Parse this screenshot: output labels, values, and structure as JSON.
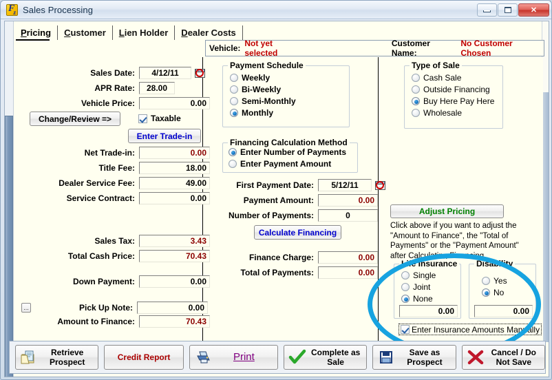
{
  "window": {
    "title": "Sales Processing",
    "icon": "app-icon-fz",
    "buttons": {
      "minimize": "minimize",
      "maximize": "maximize",
      "close": "close"
    }
  },
  "tabs": [
    {
      "label": "Pricing",
      "mnemonic": "P",
      "active": true
    },
    {
      "label": "Customer",
      "mnemonic": "C",
      "active": false
    },
    {
      "label": "Lien Holder",
      "mnemonic": "L",
      "active": false
    },
    {
      "label": "Dealer Costs",
      "mnemonic": "D",
      "active": false
    }
  ],
  "header": {
    "vehicle_label": "Vehicle:",
    "vehicle_value": "Not yet selected",
    "customer_label": "Customer Name:",
    "customer_value": "No Customer Chosen",
    "value_color": "#c00000"
  },
  "left_column": {
    "sales_date": {
      "label": "Sales Date:",
      "value": "4/12/11",
      "icon": "calendar-icon"
    },
    "apr_rate": {
      "label": "APR Rate:",
      "value": "28.00"
    },
    "vehicle_price": {
      "label": "Vehicle Price:",
      "value": "0.00"
    },
    "change_review_button": "Change/Review =>",
    "taxable": {
      "label": "Taxable",
      "checked": true
    },
    "enter_trade_in_button": "Enter Trade-in",
    "net_trade_in": {
      "label": "Net Trade-in:",
      "value": "0.00"
    },
    "title_fee": {
      "label": "Title Fee:",
      "value": "18.00"
    },
    "dealer_service_fee": {
      "label": "Dealer Service Fee:",
      "value": "49.00"
    },
    "service_contract": {
      "label": "Service Contract:",
      "value": "0.00"
    },
    "sales_tax": {
      "label": "Sales Tax:",
      "value": "3.43"
    },
    "total_cash_price": {
      "label": "Total Cash Price:",
      "value": "70.43"
    },
    "down_payment": {
      "label": "Down Payment:",
      "value": "0.00"
    },
    "pick_up_note": {
      "label": "Pick Up Note:",
      "value": "0.00",
      "button": "..."
    },
    "amount_to_finance": {
      "label": "Amount to Finance:",
      "value": "70.43"
    }
  },
  "middle_column": {
    "payment_schedule": {
      "title": "Payment Schedule",
      "options": [
        {
          "label": "Weekly",
          "selected": false
        },
        {
          "label": "Bi-Weekly",
          "selected": false
        },
        {
          "label": "Semi-Monthly",
          "selected": false
        },
        {
          "label": "Monthly",
          "selected": true
        }
      ]
    },
    "financing_calculation_method": {
      "title": "Financing Calculation Method",
      "options": [
        {
          "label": "Enter Number of Payments",
          "selected": true
        },
        {
          "label": "Enter Payment Amount",
          "selected": false
        }
      ]
    },
    "first_payment_date": {
      "label": "First Payment Date:",
      "value": "5/12/11",
      "icon": "calendar-icon"
    },
    "payment_amount": {
      "label": "Payment Amount:",
      "value": "0.00"
    },
    "number_of_payments": {
      "label": "Number of Payments:",
      "value": "0"
    },
    "calculate_financing_button": "Calculate Financing",
    "finance_charge": {
      "label": "Finance Charge:",
      "value": "0.00"
    },
    "total_of_payments": {
      "label": "Total of Payments:",
      "value": "0.00"
    }
  },
  "right_column": {
    "type_of_sale": {
      "title": "Type of Sale",
      "options": [
        {
          "label": "Cash Sale",
          "selected": false
        },
        {
          "label": "Outside Financing",
          "selected": false
        },
        {
          "label": "Buy Here Pay Here",
          "selected": true
        },
        {
          "label": "Wholesale",
          "selected": false
        }
      ]
    },
    "adjust_pricing_button": "Adjust Pricing",
    "adjust_pricing_help": "Click above if you want to adjust the \"Amount to Finance\", the \"Total of Payments\" or the \"Payment Amount\" after Calculating Financing.",
    "life_insurance": {
      "title": "Life Insurance",
      "options": [
        {
          "label": "Single",
          "selected": false
        },
        {
          "label": "Joint",
          "selected": false
        },
        {
          "label": "None",
          "selected": true
        }
      ],
      "amount": "0.00"
    },
    "disability": {
      "title": "Disability",
      "options": [
        {
          "label": "Yes",
          "selected": false
        },
        {
          "label": "No",
          "selected": true
        }
      ],
      "amount": "0.00"
    },
    "enter_insurance_manually": {
      "label": "Enter Insurance Amounts Manually",
      "checked": true
    }
  },
  "bottom_buttons": [
    {
      "name": "retrieve-prospect",
      "line1": "Retrieve",
      "line2": "Prospect",
      "icon": "folder-document-icon",
      "color": "#000000"
    },
    {
      "name": "credit-report",
      "line1": "Credit Report",
      "line2": "",
      "icon": "none",
      "color": "#aa0000"
    },
    {
      "name": "print",
      "line1": "Print",
      "line2": "",
      "icon": "printer-icon",
      "color": "#800080"
    },
    {
      "name": "complete-as-sale",
      "line1": "Complete as",
      "line2": "Sale",
      "icon": "green-check-icon",
      "color": "#000000"
    },
    {
      "name": "save-as-prospect",
      "line1": "Save as",
      "line2": "Prospect",
      "icon": "floppy-disk-icon",
      "color": "#000000"
    },
    {
      "name": "cancel-do-not-save",
      "line1": "Cancel / Do",
      "line2": "Not Save",
      "icon": "red-x-icon",
      "color": "#000000"
    }
  ],
  "annotation": {
    "shape": "ellipse",
    "color": "#17a3e0",
    "target": "insurance-section"
  }
}
